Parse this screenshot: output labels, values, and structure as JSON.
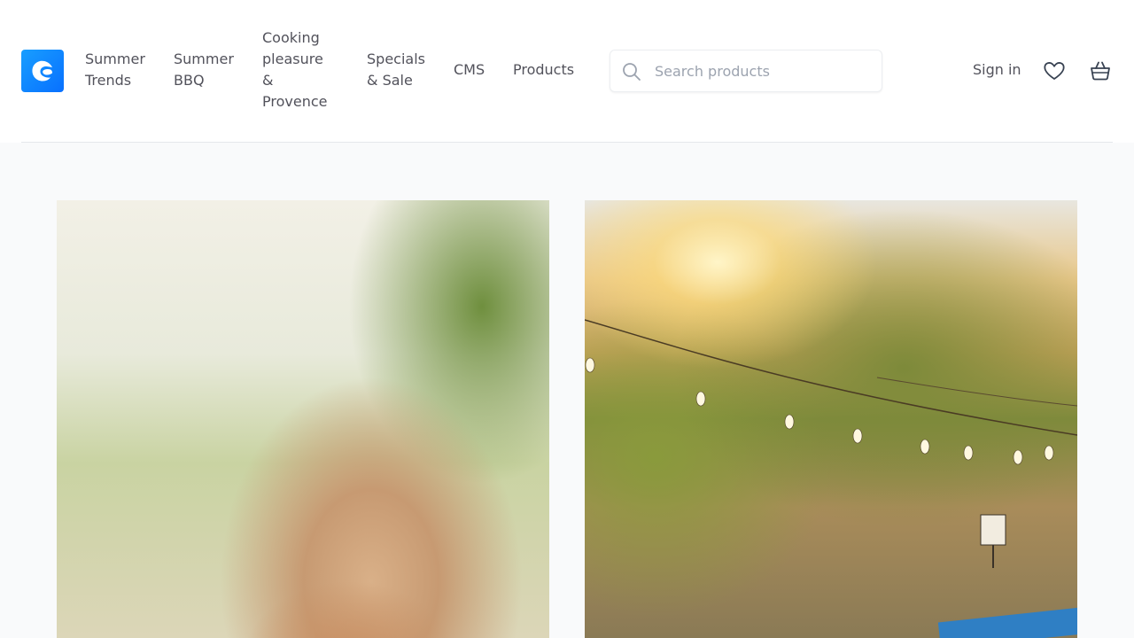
{
  "header": {
    "logo_icon": "shopware-logo-icon",
    "nav": [
      {
        "label_line1": "Summer",
        "label_line2": "Trends"
      },
      {
        "label_line1": "Summer",
        "label_line2": "BBQ"
      },
      {
        "label_line1": "Cooking",
        "label_line2": "pleasure",
        "label_line3": "&",
        "label_line4": "Provence"
      },
      {
        "label_line1": "Specials",
        "label_line2": "& Sale"
      },
      {
        "label_line1": "CMS"
      },
      {
        "label_line1": "Products"
      }
    ],
    "search": {
      "placeholder": "Search products",
      "icon": "search-icon"
    },
    "sign_in": "Sign in",
    "wishlist_icon": "heart-icon",
    "cart_icon": "basket-icon"
  },
  "content": {
    "images": [
      {
        "name": "child-hair-photo"
      },
      {
        "name": "sunset-garden-photo"
      }
    ]
  },
  "colors": {
    "accent": "#189eff",
    "page_bg": "#f9fafb",
    "header_bg": "#ffffff",
    "nav_text": "#52525b"
  }
}
